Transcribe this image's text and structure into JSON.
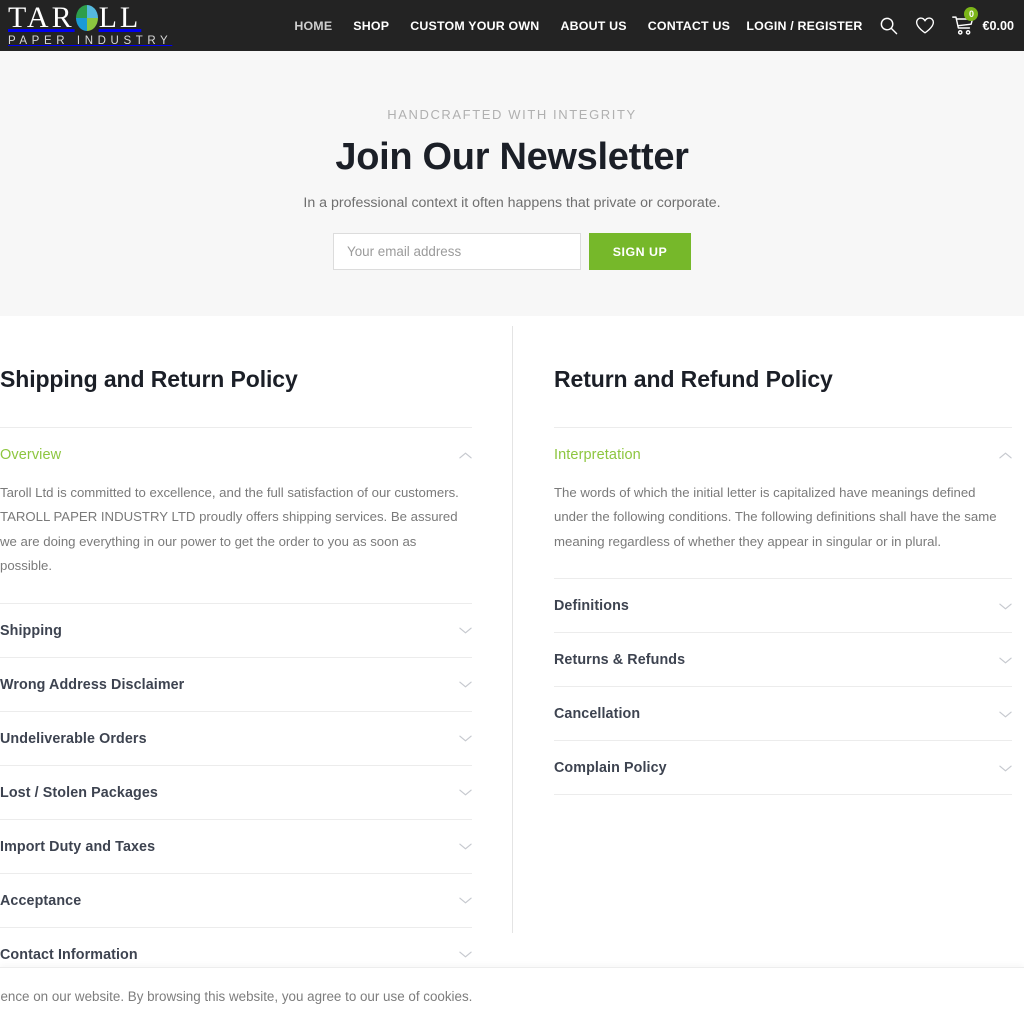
{
  "header": {
    "logo": {
      "word_left": "TAR",
      "word_right": "LL",
      "tagline": "PAPER INDUSTRY",
      "leaf_colors": {
        "top_left": "#2e9e4c",
        "top_right": "#55b9dd",
        "bottom_left": "#1b9ad6",
        "bottom_right": "#8cc63f"
      }
    },
    "nav": [
      {
        "label": "HOME",
        "active": true
      },
      {
        "label": "SHOP",
        "active": false
      },
      {
        "label": "CUSTOM YOUR OWN",
        "active": false
      },
      {
        "label": "ABOUT US",
        "active": false
      },
      {
        "label": "CONTACT US",
        "active": false
      }
    ],
    "login_label": "LOGIN / REGISTER",
    "search_icon": "search-icon",
    "wishlist_icon": "heart-icon",
    "cart_icon": "shopping-cart-icon",
    "cart_count": "0",
    "cart_total": "€0.00",
    "background_color": "#232323",
    "cart_badge_color": "#7cb518"
  },
  "newsletter": {
    "eyebrow": "HANDCRAFTED WITH INTEGRITY",
    "title": "Join Our Newsletter",
    "subtitle": "In a professional context it often happens that private or corporate.",
    "email_placeholder": "Your email address",
    "email_value": "",
    "signup_label": "SIGN UP",
    "button_color": "#76b82a",
    "background_color": "#f7f7f7"
  },
  "policy_left": {
    "title": "Shipping and Return Policy",
    "items": [
      {
        "label": "Overview",
        "open": true,
        "body": "Taroll Ltd is committed to excellence, and the full satisfaction of our customers. TAROLL PAPER INDUSTRY LTD   proudly offers shipping services. Be assured we are doing everything in our power to get the order to you as soon as possible."
      },
      {
        "label": "Shipping",
        "open": false,
        "body": ""
      },
      {
        "label": "Wrong Address Disclaimer",
        "open": false,
        "body": ""
      },
      {
        "label": "Undeliverable Orders",
        "open": false,
        "body": ""
      },
      {
        "label": "Lost / Stolen Packages",
        "open": false,
        "body": ""
      },
      {
        "label": "Import Duty and Taxes",
        "open": false,
        "body": ""
      },
      {
        "label": "Acceptance",
        "open": false,
        "body": ""
      },
      {
        "label": "Contact Information",
        "open": false,
        "body": ""
      }
    ]
  },
  "policy_right": {
    "title": "Return and Refund Policy",
    "items": [
      {
        "label": "Interpretation",
        "open": true,
        "body": "The words of which the initial letter is capitalized have meanings defined under the following conditions. The following definitions shall have the same meaning regardless of whether they appear in singular or in plural."
      },
      {
        "label": "Definitions",
        "open": false,
        "body": ""
      },
      {
        "label": "Returns & Refunds",
        "open": false,
        "body": ""
      },
      {
        "label": "Cancellation",
        "open": false,
        "body": ""
      },
      {
        "label": "Complain Policy",
        "open": false,
        "body": ""
      }
    ]
  },
  "cookie_bar": {
    "text": "We use cookies to improve your experience on our website. By browsing this website, you agree to our use of cookies."
  },
  "accent_colors": {
    "green": "#8dc63f",
    "button_green": "#76b82a",
    "heading": "#1b1f27",
    "body_text": "#7a7a7a"
  }
}
